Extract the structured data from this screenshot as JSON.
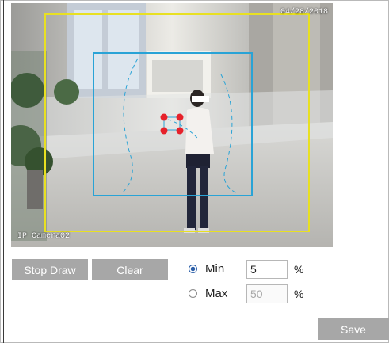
{
  "video": {
    "timestamp": "04/28/2018",
    "camera_label": "IP Camera02"
  },
  "controls": {
    "stop_draw_label": "Stop Draw",
    "clear_label": "Clear",
    "min_label": "Min",
    "max_label": "Max",
    "min_value": "5",
    "max_value": "50",
    "min_unit": "%",
    "max_unit": "%",
    "selected": "min",
    "save_label": "Save"
  },
  "colors": {
    "outer_region": "#e8e022",
    "inner_region": "#29a3d6",
    "marker": "#e6212a",
    "button_bg": "#a7a7a7"
  }
}
